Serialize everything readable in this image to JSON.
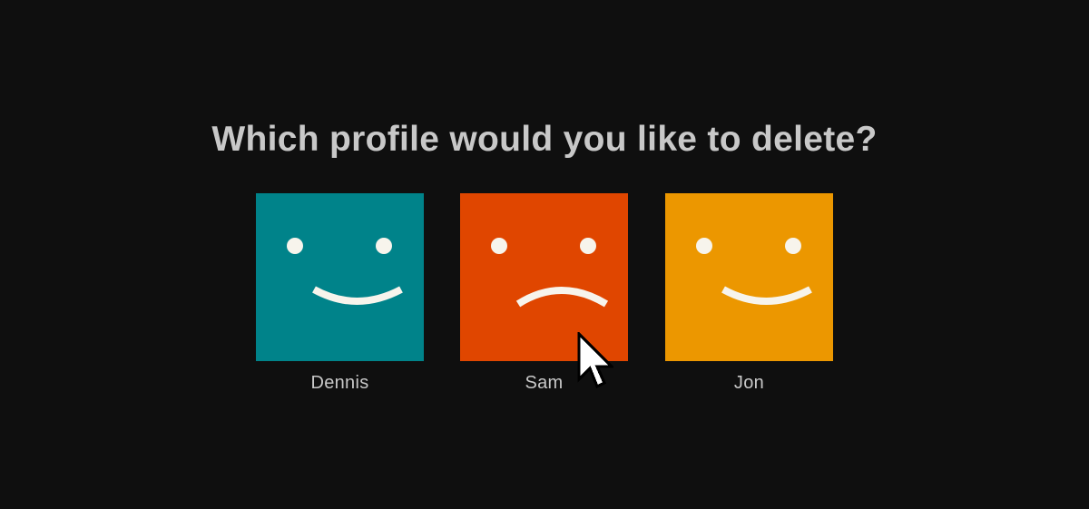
{
  "prompt": {
    "title": "Which profile would you like to delete?"
  },
  "profiles": [
    {
      "name": "Dennis",
      "color": "#00838a",
      "expression": "smile-face-icon"
    },
    {
      "name": "Sam",
      "color": "#e04600",
      "expression": "frown-face-icon"
    },
    {
      "name": "Jon",
      "color": "#ec9700",
      "expression": "smile-face-icon"
    }
  ],
  "colors": {
    "background": "#0f0f0f",
    "text": "#c8c8c8",
    "face": "#f7f4ec"
  },
  "cursor": {
    "icon": "arrow-cursor-icon",
    "hovering": "Sam"
  }
}
